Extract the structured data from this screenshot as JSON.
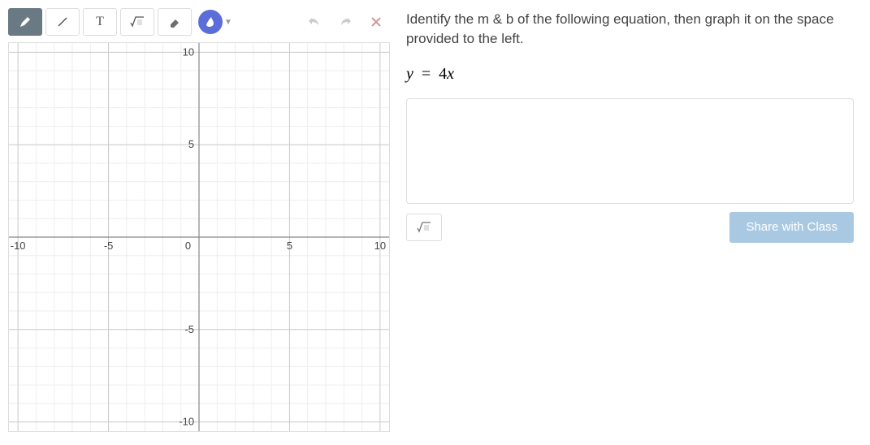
{
  "instruction": "Identify the m & b of the following equation, then graph it on the space provided to the left.",
  "equation": {
    "lhs": "y",
    "eq": "=",
    "rhs_coef": "4",
    "rhs_var": "x"
  },
  "share_button": "Share with Class",
  "toolbar": {
    "marker_icon": "marker",
    "line_icon": "line",
    "text_icon": "T",
    "math_icon": "√",
    "eraser_icon": "eraser",
    "ink_icon": "ink",
    "undo_icon": "undo",
    "redo_icon": "redo",
    "close_icon": "×"
  },
  "math_toggle_icon": "√",
  "chart_data": {
    "type": "scatter",
    "title": "",
    "xlabel": "",
    "ylabel": "",
    "xlim": [
      -10.5,
      10.5
    ],
    "ylim": [
      -10.5,
      10.5
    ],
    "x_ticks": [
      -10,
      -5,
      0,
      5,
      10
    ],
    "y_ticks": [
      -10,
      -5,
      0,
      5,
      10
    ],
    "series": []
  }
}
